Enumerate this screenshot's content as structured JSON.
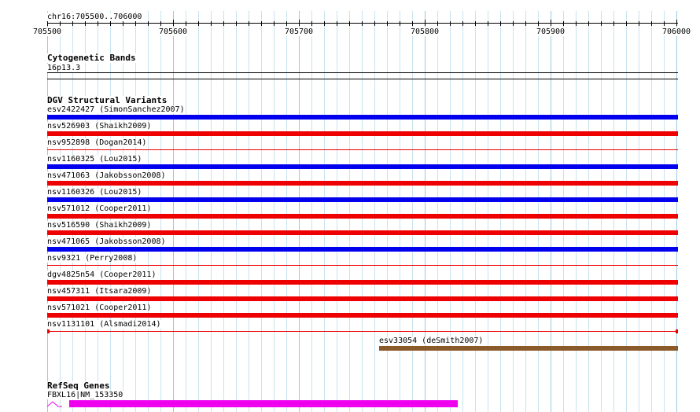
{
  "ruler": {
    "region": "chr16:705500..706000",
    "ticks": [
      "705500",
      "705600",
      "705700",
      "705800",
      "705900",
      "706000"
    ],
    "start": 705500,
    "end": 706000
  },
  "cytoband": {
    "title": "Cytogenetic Bands",
    "band": "16p13.3"
  },
  "dgv": {
    "title": "DGV Structural Variants",
    "features": [
      {
        "label": "esv2422427 (SimonSanchez2007)",
        "color": "#0000ee",
        "start": 705500,
        "end": 706000,
        "style": "thick"
      },
      {
        "label": "nsv526903 (Shaikh2009)",
        "color": "#ee0000",
        "start": 705500,
        "end": 706000,
        "style": "thick"
      },
      {
        "label": "nsv952898 (Dogan2014)",
        "color": "#ee0000",
        "start": 705500,
        "end": 706000,
        "style": "thin"
      },
      {
        "label": "nsv1160325 (Lou2015)",
        "color": "#0000ee",
        "start": 705500,
        "end": 706000,
        "style": "thick"
      },
      {
        "label": "nsv471063 (Jakobsson2008)",
        "color": "#ee0000",
        "start": 705500,
        "end": 706000,
        "style": "thick"
      },
      {
        "label": "nsv1160326 (Lou2015)",
        "color": "#0000ee",
        "start": 705500,
        "end": 706000,
        "style": "thick"
      },
      {
        "label": "nsv571012 (Cooper2011)",
        "color": "#ee0000",
        "start": 705500,
        "end": 706000,
        "style": "thick"
      },
      {
        "label": "nsv516590 (Shaikh2009)",
        "color": "#ee0000",
        "start": 705500,
        "end": 706000,
        "style": "thick"
      },
      {
        "label": "nsv471065 (Jakobsson2008)",
        "color": "#0000ee",
        "start": 705500,
        "end": 706000,
        "style": "thick"
      },
      {
        "label": "nsv9321 (Perry2008)",
        "color": "#ee0000",
        "start": 705500,
        "end": 706000,
        "style": "thin"
      },
      {
        "label": "dgv4825n54 (Cooper2011)",
        "color": "#ee0000",
        "start": 705500,
        "end": 706000,
        "style": "thick"
      },
      {
        "label": "nsv457311 (Itsara2009)",
        "color": "#ee0000",
        "start": 705500,
        "end": 706000,
        "style": "thick"
      },
      {
        "label": "nsv571021 (Cooper2011)",
        "color": "#ee0000",
        "start": 705500,
        "end": 706000,
        "style": "thick"
      },
      {
        "label": "nsv1131101 (Alsmadi2014)",
        "color": "#ee0000",
        "start": 705500,
        "end": 706000,
        "style": "capped"
      },
      {
        "label": "esv33054 (deSmith2007)",
        "color": "#8b5a2b",
        "start": 705764,
        "end": 706000,
        "style": "thick"
      }
    ]
  },
  "refseq": {
    "title": "RefSeq Genes",
    "gene": {
      "label": "FBXL16|NM_153350",
      "color": "#ee00ee",
      "start": 705513,
      "end": 705826
    }
  }
}
